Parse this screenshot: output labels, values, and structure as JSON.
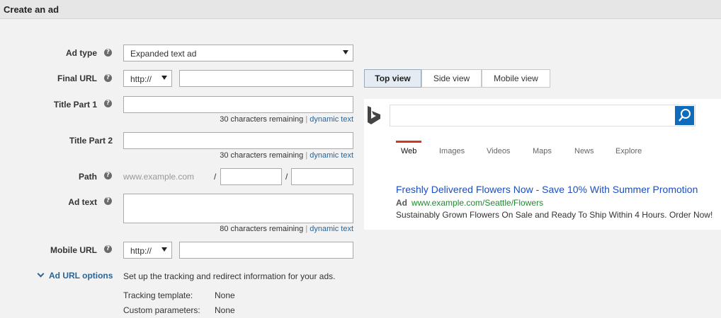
{
  "header": {
    "title": "Create an ad"
  },
  "form": {
    "ad_type": {
      "label": "Ad type",
      "value": "Expanded text ad"
    },
    "final_url": {
      "label": "Final URL",
      "protocol": "http://",
      "value": ""
    },
    "title_part_1": {
      "label": "Title Part 1",
      "value": "",
      "remaining": "30 characters remaining",
      "separator": "|",
      "dynamic_link": "dynamic text"
    },
    "title_part_2": {
      "label": "Title Part 2",
      "value": "",
      "remaining": "30 characters remaining",
      "separator": "|",
      "dynamic_link": "dynamic text"
    },
    "path": {
      "label": "Path",
      "domain": "www.example.com",
      "slash1": "/",
      "slash2": "/"
    },
    "ad_text": {
      "label": "Ad text",
      "value": "",
      "remaining": "80 characters remaining",
      "separator": "|",
      "dynamic_link": "dynamic text"
    },
    "mobile_url": {
      "label": "Mobile URL",
      "protocol": "http://",
      "value": ""
    },
    "ad_url_options": {
      "label": "Ad URL options",
      "description": "Set up the tracking and redirect information for your ads.",
      "tracking_template_label": "Tracking template:",
      "tracking_template_value": "None",
      "custom_parameters_label": "Custom parameters:",
      "custom_parameters_value": "None"
    }
  },
  "preview": {
    "tabs": [
      {
        "label": "Top view",
        "active": true
      },
      {
        "label": "Side view",
        "active": false
      },
      {
        "label": "Mobile view",
        "active": false
      }
    ],
    "nav": [
      "Web",
      "Images",
      "Videos",
      "Maps",
      "News",
      "Explore"
    ],
    "ad": {
      "title": "Freshly Delivered Flowers Now - Save 10% With Summer Promotion",
      "badge": "Ad",
      "url": "www.example.com/Seattle/Flowers",
      "description": "Sustainably Grown Flowers On Sale and Ready To Ship Within 4 Hours. Order Now!"
    }
  },
  "icons": {
    "help": "?"
  },
  "colors": {
    "link": "#2a6496",
    "ad_title": "#1a4fc1",
    "ad_url": "#1e8a2e",
    "search_button": "#0f6cbd",
    "nav_active": "#cc3a20"
  }
}
